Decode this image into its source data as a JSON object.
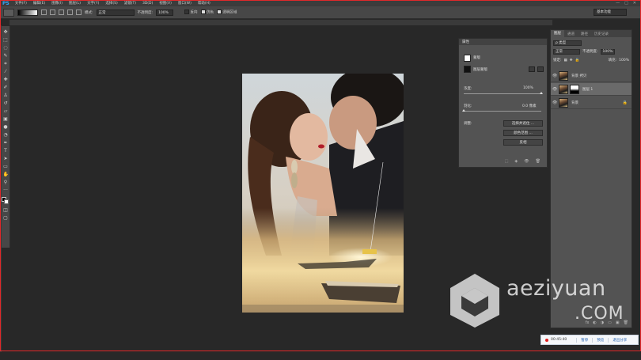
{
  "app": {
    "logo": "PS"
  },
  "menu": [
    "文件(F)",
    "编辑(E)",
    "图像(I)",
    "图层(L)",
    "文字(Y)",
    "选择(S)",
    "滤镜(T)",
    "3D(D)",
    "视图(V)",
    "窗口(W)",
    "帮助(H)"
  ],
  "window_controls": [
    "—",
    "□",
    "✕"
  ],
  "options": {
    "mode_label": "模式:",
    "mode_value": "正常",
    "opacity_label": "不透明度:",
    "opacity_value": "100%",
    "reverse_label": "反向",
    "dither_label": "仿色",
    "transparency_label": "透明区域",
    "reverse_checked": false,
    "dither_checked": true,
    "transparency_checked": true,
    "workspace": "基本功能"
  },
  "properties": {
    "title": "属性",
    "section": "蒙版",
    "layer_mask_label": "图层蒙版",
    "density_label": "浓度:",
    "density_value": "100%",
    "density_fraction": 1.0,
    "feather_label": "羽化:",
    "feather_value": "0.0 像素",
    "feather_fraction": 0.0,
    "refine_label": "调整:",
    "buttons": [
      "选择并遮住 ...",
      "颜色范围 ...",
      "反相"
    ],
    "footer_icons": [
      "⬚",
      "◈",
      "👁",
      "🗑"
    ]
  },
  "layers": {
    "tabs": [
      "图层",
      "通道",
      "路径",
      "历史记录"
    ],
    "active_tab": 0,
    "filter_label": "ρ 类型",
    "blend_mode": "正常",
    "opacity_label": "不透明度:",
    "opacity_value": "100%",
    "lock_label": "锁定:",
    "fill_label": "填充:",
    "fill_value": "100%",
    "items": [
      {
        "name": "背景 拷贝",
        "visible": true,
        "selected": false,
        "mask": false,
        "locked": false
      },
      {
        "name": "图层 1",
        "visible": true,
        "selected": true,
        "mask": true,
        "locked": false
      },
      {
        "name": "背景",
        "visible": true,
        "selected": false,
        "mask": false,
        "locked": true
      }
    ],
    "footer_icons": [
      "fx",
      "◐",
      "◑",
      "▭",
      "▣",
      "🗑"
    ]
  },
  "watermark": {
    "brand": "aeziyuan",
    "suffix": ".COM"
  },
  "recording": {
    "time": "00:45:40",
    "buttons": [
      "暂停",
      "预览",
      "退出分享"
    ]
  },
  "colors": {
    "ui_dark": "#282828",
    "panel": "#535353",
    "accent_ps": "#31a8ff",
    "rec_red": "#e02020",
    "frame_red": "#e0282a"
  }
}
